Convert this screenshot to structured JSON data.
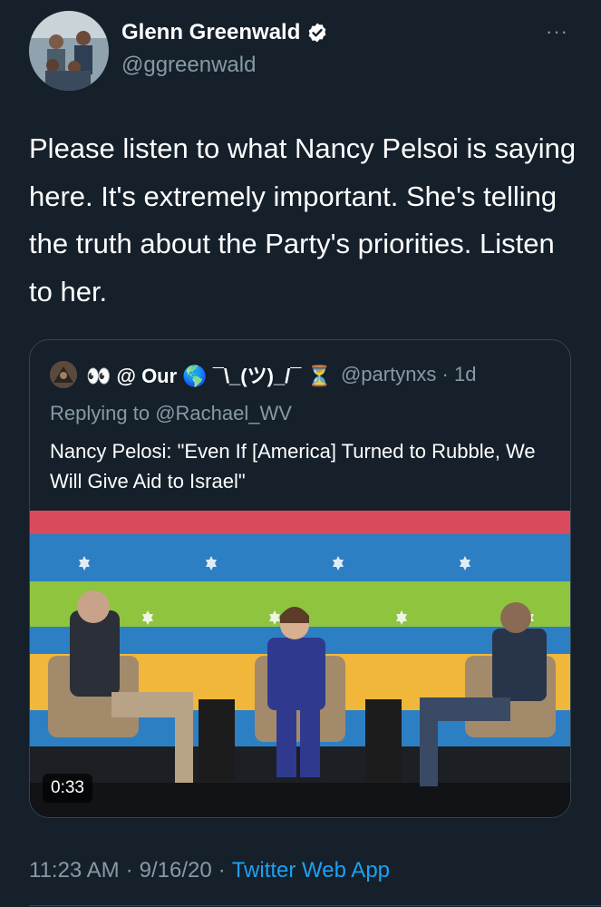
{
  "author": {
    "name": "Glenn Greenwald",
    "handle": "@ggreenwald",
    "avatar_icon": "profile-photo",
    "verified_icon": "verified-badge-icon"
  },
  "more_label": "···",
  "tweet": {
    "text": "Please listen to what Nancy Pelsoi is saying here. It's extremely important. She's telling the truth about the Party's priorities. Listen to her."
  },
  "quoted": {
    "name": "👀 @ Our 🌎 ¯\\_(ツ)_/¯ ⏳",
    "handle": "@partynxs · 1d",
    "replying_prefix": "Replying to ",
    "replying_to": "@Rachael_WV",
    "text": "Nancy Pelosi: \"Even If [America] Turned to Rubble, We Will Give Aid to Israel\"",
    "media": {
      "type": "video",
      "duration": "0:33"
    }
  },
  "footer": {
    "time": "11:23 AM",
    "sep1": "·",
    "date": "9/16/20",
    "sep2": "·",
    "source": "Twitter Web App"
  },
  "colors": {
    "background": "#15202b",
    "secondary_text": "#8899a6",
    "link": "#1da1f2",
    "border": "#38444d"
  }
}
